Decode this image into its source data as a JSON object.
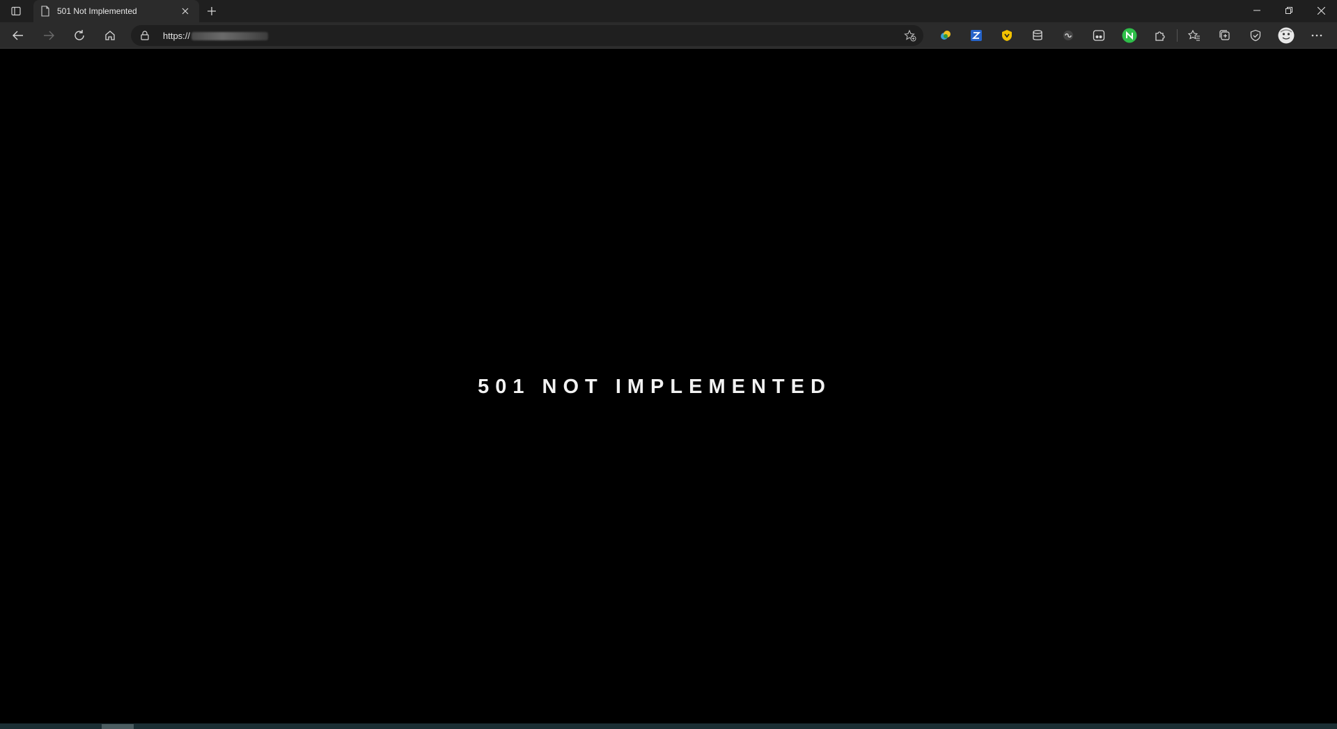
{
  "browser": {
    "tab": {
      "title": "501 Not Implemented"
    },
    "address_bar": {
      "url_prefix": "https://"
    },
    "extensions": [
      "eye-dropper-icon",
      "zotero-icon",
      "shield-icon",
      "stack-icon",
      "link-icon",
      "sponsor-block-icon",
      "n-green-icon",
      "puzzle-icon"
    ],
    "toolbar_icons": [
      "favorites-icon",
      "collections-icon",
      "shield-check-icon",
      "profile-avatar",
      "more-icon"
    ]
  },
  "page": {
    "error_message": "501 NOT IMPLEMENTED"
  },
  "colors": {
    "page_background": "#000000",
    "chrome_background": "#2b2b2b",
    "tabstrip_background": "#1f1f1f",
    "text": "#f2f2f2"
  }
}
